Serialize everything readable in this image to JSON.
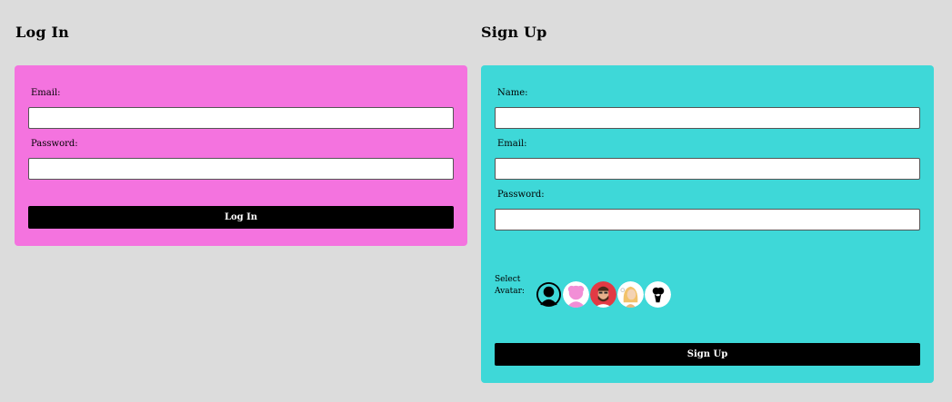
{
  "login": {
    "title": "Log In",
    "email_label": "Email:",
    "password_label": "Password:",
    "email_value": "",
    "password_value": "",
    "button_label": "Log In",
    "card_color": "#f473df"
  },
  "signup": {
    "title": "Sign Up",
    "name_label": "Name:",
    "email_label": "Email:",
    "password_label": "Password:",
    "name_value": "",
    "email_value": "",
    "password_value": "",
    "avatar_label": "Select Avatar:",
    "avatars": [
      {
        "icon": "black-silhouette-avatar-icon"
      },
      {
        "icon": "pink-silhouette-avatar-icon"
      },
      {
        "icon": "bearded-man-avatar-icon"
      },
      {
        "icon": "blonde-woman-avatar-icon"
      },
      {
        "icon": "black-figure-avatar-icon"
      }
    ],
    "button_label": "Sign Up",
    "card_color": "#3ed8d8"
  },
  "colors": {
    "background": "#dcdcdc",
    "button": "#000000",
    "button_text": "#ffffff"
  }
}
